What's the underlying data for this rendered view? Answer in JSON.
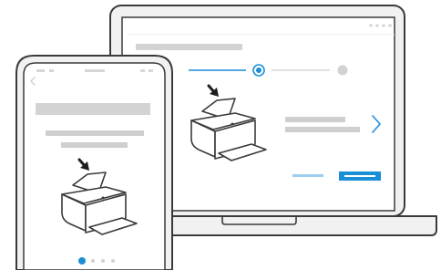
{
  "illustration": {
    "colors": {
      "outline": "#3a3a3a",
      "screen_fill": "#ffffff",
      "device_fill": "#f1f1f1",
      "placeholder": "#cfcfcf",
      "placeholder_light": "#dcdcdc",
      "accent": "#1a8ed6",
      "accent_light": "#9ccfee",
      "inactive_dot": "#d2d2d2"
    },
    "icons": {
      "printer": "printer-icon",
      "arrow_down": "arrow-down-icon",
      "chevron_right": "chevron-right-icon",
      "chevron_left": "chevron-left-icon"
    },
    "laptop": {
      "stepper": {
        "total_steps": 3,
        "current_step": 2
      }
    },
    "phone": {
      "carousel": {
        "total_dots": 4,
        "active_dot": 1
      }
    }
  }
}
